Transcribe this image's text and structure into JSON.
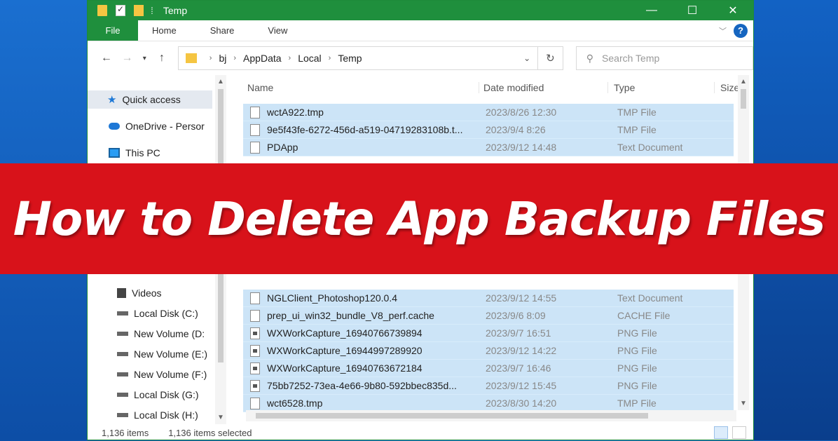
{
  "window": {
    "title": "Temp",
    "controls": {
      "minimize": "—",
      "maximize": "☐",
      "close": "✕"
    }
  },
  "ribbon": {
    "tabs": [
      "File",
      "Home",
      "Share",
      "View"
    ],
    "help_label": "?"
  },
  "address": {
    "crumbs": [
      "bj",
      "AppData",
      "Local",
      "Temp"
    ],
    "search_placeholder": "Search Temp"
  },
  "navigation": {
    "items": [
      {
        "label": "Quick access",
        "icon": "star-icon"
      },
      {
        "label": "OneDrive - Persor",
        "icon": "cloud-icon"
      },
      {
        "label": "This PC",
        "icon": "pc-icon"
      },
      {
        "label": "Videos",
        "icon": "video-icon"
      },
      {
        "label": "Local Disk (C:)",
        "icon": "disk-icon"
      },
      {
        "label": "New Volume (D:",
        "icon": "disk-icon"
      },
      {
        "label": "New Volume (E:)",
        "icon": "disk-icon"
      },
      {
        "label": "New Volume (F:)",
        "icon": "disk-icon"
      },
      {
        "label": "Local Disk (G:)",
        "icon": "disk-icon"
      },
      {
        "label": "Local Disk (H:)",
        "icon": "disk-icon"
      }
    ]
  },
  "file_list": {
    "columns": [
      "Name",
      "Date modified",
      "Type",
      "Size"
    ],
    "rows": [
      {
        "name": "wctA922.tmp",
        "date": "2023/8/26 12:30",
        "type": "TMP File",
        "icon": "file-icon"
      },
      {
        "name": "9e5f43fe-6272-456d-a519-04719283108b.t...",
        "date": "2023/9/4 8:26",
        "type": "TMP File",
        "icon": "file-icon"
      },
      {
        "name": "PDApp",
        "date": "2023/9/12 14:48",
        "type": "Text Document",
        "icon": "file-icon"
      },
      {
        "name": "NGLClient_Photoshop120.0.4",
        "date": "2023/9/12 14:55",
        "type": "Text Document",
        "icon": "file-icon"
      },
      {
        "name": "prep_ui_win32_bundle_V8_perf.cache",
        "date": "2023/9/6 8:09",
        "type": "CACHE File",
        "icon": "file-icon"
      },
      {
        "name": "WXWorkCapture_16940766739894",
        "date": "2023/9/7 16:51",
        "type": "PNG File",
        "icon": "image-file-icon"
      },
      {
        "name": "WXWorkCapture_16944997289920",
        "date": "2023/9/12 14:22",
        "type": "PNG File",
        "icon": "image-file-icon"
      },
      {
        "name": "WXWorkCapture_16940763672184",
        "date": "2023/9/7 16:46",
        "type": "PNG File",
        "icon": "image-file-icon"
      },
      {
        "name": "75bb7252-73ea-4e66-9b80-592bbec835d...",
        "date": "2023/9/12 15:45",
        "type": "PNG File",
        "icon": "image-file-icon"
      },
      {
        "name": "wct6528.tmp",
        "date": "2023/8/30 14:20",
        "type": "TMP File",
        "icon": "file-icon"
      }
    ]
  },
  "status": {
    "item_count": "1,136 items",
    "selected": "1,136 items selected"
  },
  "banner": {
    "text": "How to Delete App Backup Files"
  },
  "colors": {
    "title_bar": "#1f8f3d",
    "banner": "#d8121a",
    "selection": "#cce4f7"
  }
}
